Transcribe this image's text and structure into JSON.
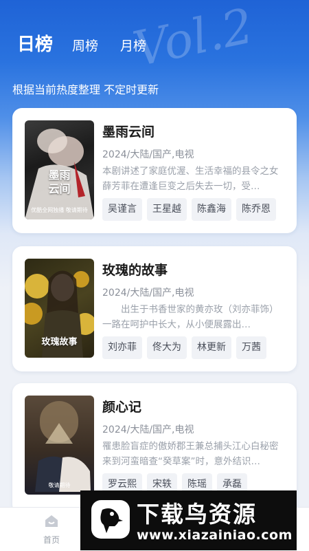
{
  "tabs": [
    {
      "label": "日榜",
      "active": true
    },
    {
      "label": "周榜",
      "active": false
    },
    {
      "label": "月榜",
      "active": false
    }
  ],
  "subtitle": "根据当前热度整理 不定时更新",
  "cards": [
    {
      "title": "墨雨云间",
      "meta": "2024/大陆/国产,电视",
      "desc": "本剧讲述了家庭优渥、生活幸福的县令之女薛芳菲在遭逢巨变之后失去一切，受…",
      "actors": [
        "吴谨言",
        "王星越",
        "陈鑫海",
        "陈乔恩"
      ],
      "poster_title": "墨雨\n云间",
      "poster_tag": "优酷全网独播 敬请期待"
    },
    {
      "title": "玫瑰的故事",
      "meta": "2024/大陆/国产,电视",
      "desc": "　　出生于书香世家的黄亦玫（刘亦菲饰）一路在呵护中长大，从小便展露出…",
      "actors": [
        "刘亦菲",
        "佟大为",
        "林更新",
        "万茜"
      ],
      "poster_title": "玫瑰故事",
      "poster_tag": ""
    },
    {
      "title": "颜心记",
      "meta": "2024/大陆/国产,电视",
      "desc": "罹患脸盲症的傲娇郡王兼总捕头江心白秘密来到河蛮暗查“癸草案”时，意外结识…",
      "actors": [
        "罗云熙",
        "宋轶",
        "陈瑶",
        "承磊"
      ],
      "poster_title": "颜心记",
      "poster_tag": "敬请期待"
    }
  ],
  "bottom_nav": {
    "home_label": "首页"
  },
  "watermark": {
    "title": "下载鸟资源",
    "url": "www.xiazainiao.com"
  },
  "colors": {
    "brand_blue": "#1f63d6",
    "card_bg": "#ffffff",
    "chip_bg": "#f0f2f6"
  }
}
